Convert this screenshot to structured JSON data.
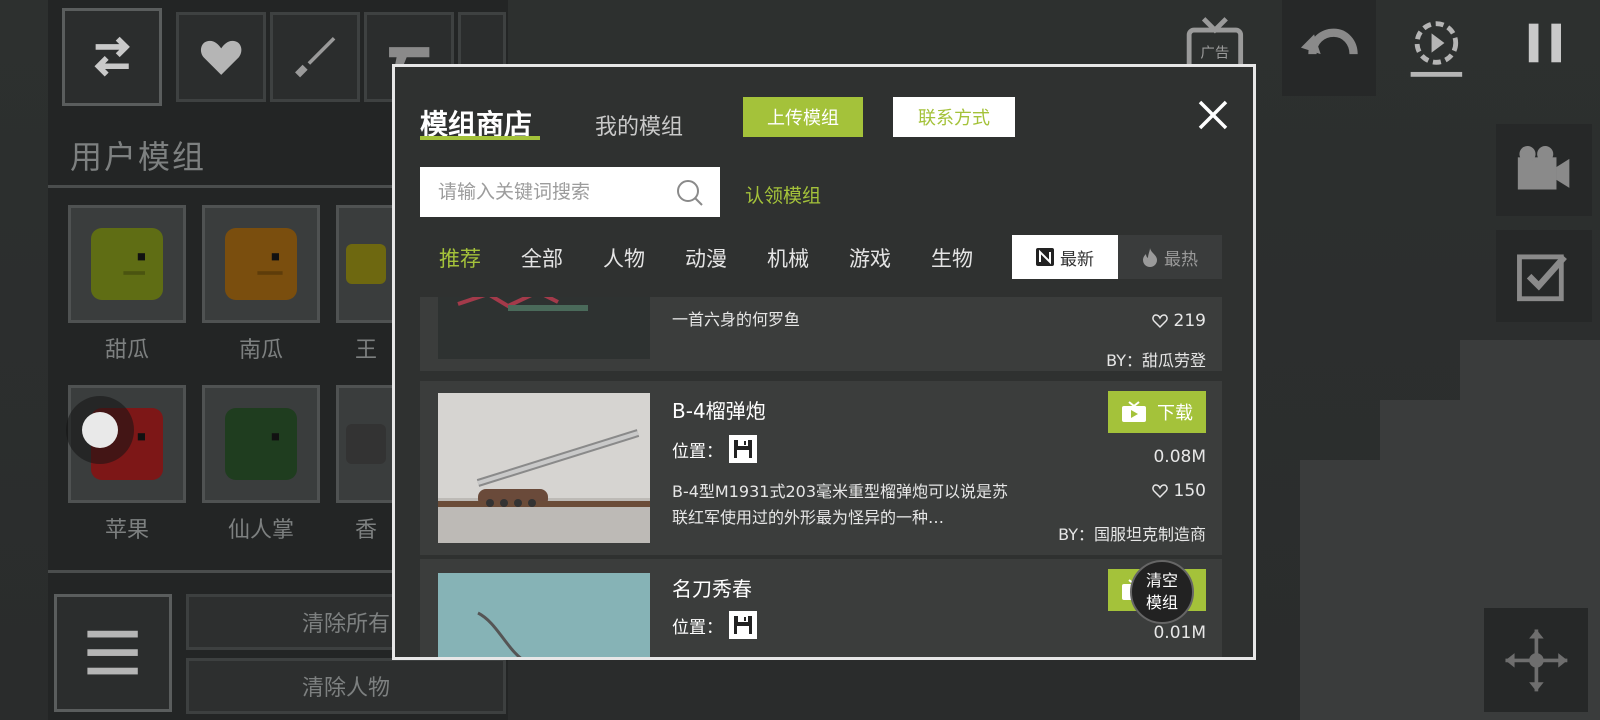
{
  "background": {
    "section_title": "用户模组",
    "items": [
      {
        "label": "甜瓜",
        "color": "#6b7a17"
      },
      {
        "label": "南瓜",
        "color": "#8a5a10"
      },
      {
        "label": "王",
        "color": "#7a7410"
      },
      {
        "label": "苹果",
        "color": "#8c1a1a"
      },
      {
        "label": "仙人掌",
        "color": "#244a24"
      },
      {
        "label": "香",
        "color": "#3a3a3a"
      }
    ],
    "buttons": {
      "clear_all": "清除所有",
      "clear_people": "清除人物"
    },
    "ad_label": "广告"
  },
  "modal": {
    "tab_store": "模组商店",
    "tab_my_mods": "我的模组",
    "upload_label": "上传模组",
    "contact_label": "联系方式",
    "search_placeholder": "请输入关键词搜索",
    "claim_label": "认领模组",
    "categories": [
      "推荐",
      "全部",
      "人物",
      "动漫",
      "机械",
      "游戏",
      "生物"
    ],
    "active_category": "推荐",
    "sort_new": "最新",
    "sort_hot": "最热",
    "position_label": "位置：",
    "download_label": "下载",
    "mods": [
      {
        "title": "",
        "description": "一首六身的何罗鱼",
        "likes": "219",
        "author": "BY：甜瓜劳登"
      },
      {
        "title": "B-4榴弹炮",
        "description": "B-4型M1931式203毫米重型榴弹炮可以说是苏联红军使用过的外形最为怪异的一种…",
        "size": "0.08M",
        "likes": "150",
        "author": "BY：国服坦克制造商"
      },
      {
        "title": "名刀秀春",
        "size": "0.01M"
      }
    ]
  },
  "clear_mods_bubble": {
    "line1": "清空",
    "line2": "模组"
  },
  "colors": {
    "accent": "#a4c23a",
    "modal_bg": "#2f3130",
    "row_bg": "#3b3d3c"
  }
}
